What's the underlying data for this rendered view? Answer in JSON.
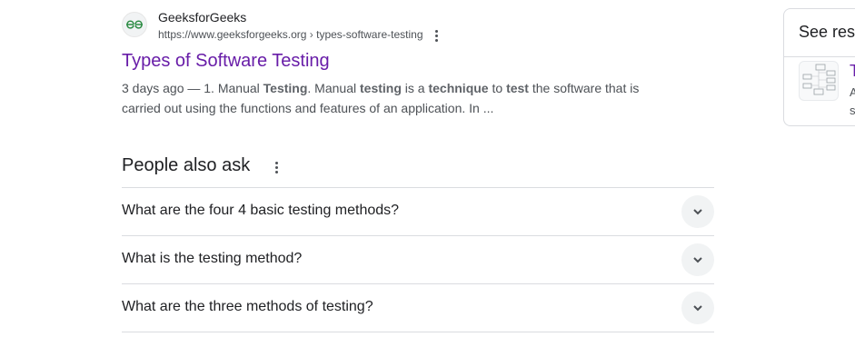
{
  "result": {
    "site_name": "GeeksforGeeks",
    "url_domain": "https://www.geeksforgeeks.org",
    "url_separator": "›",
    "url_path": "types-software-testing",
    "title": "Types of Software Testing",
    "snippet_line1": [
      {
        "t": "3 days ago — 1. Manual ",
        "b": false
      },
      {
        "t": "Testing",
        "b": true
      },
      {
        "t": ". Manual ",
        "b": false
      },
      {
        "t": "testing",
        "b": true
      },
      {
        "t": " is a ",
        "b": false
      },
      {
        "t": "technique",
        "b": true
      },
      {
        "t": " to ",
        "b": false
      },
      {
        "t": "test",
        "b": true
      },
      {
        "t": " the software that is",
        "b": false
      }
    ],
    "snippet_line2": "carried out using the functions and features of an application. In ..."
  },
  "paa": {
    "title": "People also ask",
    "questions": [
      "What are the four 4 basic testing methods?",
      "What is the testing method?",
      "What are the three methods of testing?"
    ]
  },
  "side_panel": {
    "title": "See resu",
    "item_title": "T",
    "item_sub1": "A",
    "item_sub2": "s"
  },
  "colors": {
    "visited_link": "#681da8",
    "favicon_green": "#2f8d46",
    "divider": "#dadce0"
  }
}
